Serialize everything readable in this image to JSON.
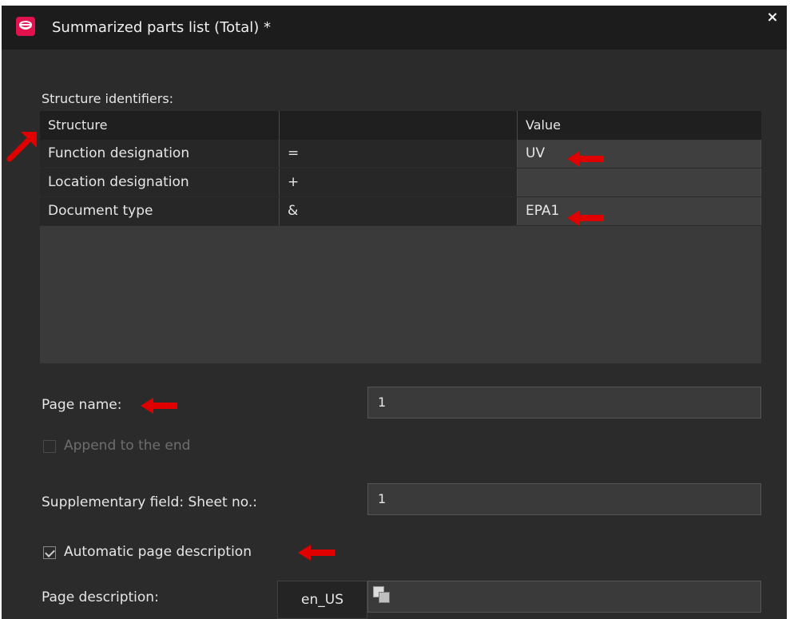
{
  "dialog": {
    "title": "Summarized parts list (Total) *",
    "close_symbol": "×"
  },
  "structure": {
    "section_label": "Structure identifiers:",
    "columns": [
      "Structure",
      "",
      "Value"
    ],
    "rows": [
      {
        "structure": "Function designation",
        "prefix": "=",
        "value": "UV"
      },
      {
        "structure": "Location designation",
        "prefix": "+",
        "value": ""
      },
      {
        "structure": "Document type",
        "prefix": "&",
        "value": "EPA1"
      }
    ]
  },
  "page_name": {
    "label": "Page name:",
    "value": "1"
  },
  "append_to_end": {
    "label": "Append to the end",
    "checked": false,
    "enabled": false
  },
  "sheet_no": {
    "label": "Supplementary field: Sheet no.:",
    "value": "1"
  },
  "auto_description": {
    "label": "Automatic page description",
    "checked": true
  },
  "page_description": {
    "label": "Page description:",
    "language": "en_US",
    "value": ""
  },
  "icons": [
    "app-logo-icon",
    "close-icon",
    "multilanguage-icon",
    "annotation-arrow-icon"
  ],
  "colors": {
    "accent": "#e2124f",
    "annotation_arrow": "#e00000",
    "dialog_bg": "#2b2b2b"
  }
}
